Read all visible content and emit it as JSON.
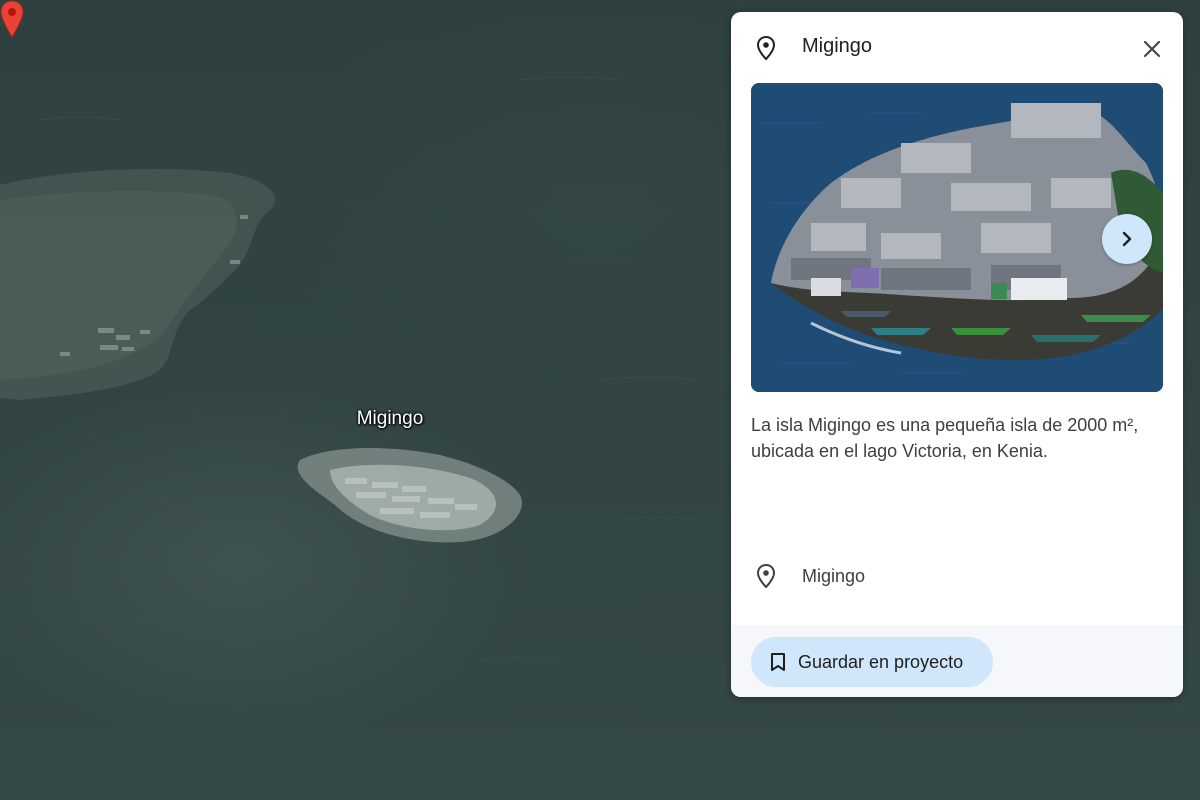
{
  "map": {
    "marker_label": "Migingo"
  },
  "panel": {
    "title": "Migingo",
    "description": "La isla Migingo es una pequeña isla de 2000 m², ubicada en el lago Victoria, en Kenia.",
    "place_name": "Migingo",
    "save_label": "Guardar en proyecto",
    "icons": {
      "header": "location-pin-icon",
      "close": "close-icon",
      "next": "chevron-right-icon",
      "place": "location-pin-icon",
      "save": "bookmark-icon"
    }
  },
  "colors": {
    "map_water": "#314443",
    "marker": "#ea4335",
    "button_bg": "#cfe6fb",
    "panel_bg": "#ffffff"
  }
}
